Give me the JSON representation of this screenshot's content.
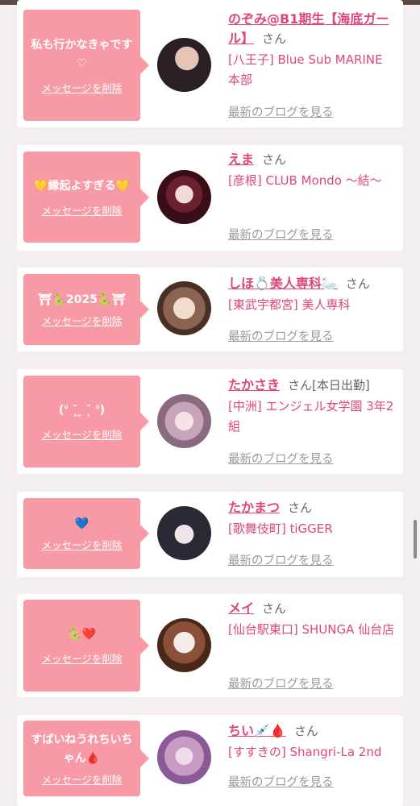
{
  "cards": [
    {
      "message": "私も行かなきゃです♡",
      "delete_label": "メッセージを削除",
      "name": "のぞみ@B1期生【海底ガール】",
      "honorific": "さん",
      "extra": "",
      "shop": "[八王子] Blue Sub MARINE 本部",
      "blog_link": "最新のブログを見る",
      "avatar_colors": [
        "#2a2024",
        "#d9b8a8"
      ]
    },
    {
      "message": "💛縁起よすぎる💛",
      "delete_label": "メッセージを削除",
      "name": "えま",
      "honorific": "さん",
      "extra": "",
      "shop": "[彦根] CLUB Mondo 〜結〜",
      "blog_link": "最新のブログを見る",
      "avatar_colors": [
        "#4a1420",
        "#e8d0c8"
      ]
    },
    {
      "message": "⛩🐍2025🐍⛩",
      "delete_label": "メッセージを削除",
      "name": "しほ💍美人専科🦢",
      "honorific": "さん",
      "extra": "",
      "shop": "[東武宇都宮] 美人専科",
      "blog_link": "最新のブログを見る",
      "avatar_colors": [
        "#6b4a38",
        "#f0d8c8"
      ]
    },
    {
      "message": "(ᐡ ˘̩̩̩ ̫ ˘̩̩̩ ᐡ)",
      "delete_label": "メッセージを削除",
      "name": "たかさき",
      "honorific": "さん",
      "extra": "[本日出勤]",
      "shop": "[中洲] エンジェル女学園 3年2組",
      "blog_link": "最新のブログを見る",
      "avatar_colors": [
        "#e8c8d8",
        "#b89aa8"
      ]
    },
    {
      "message": "💙",
      "delete_label": "メッセージを削除",
      "name": "たかまつ",
      "honorific": "さん",
      "extra": "",
      "shop": "[歌舞伎町] tiGGER",
      "blog_link": "最新のブログを見る",
      "avatar_colors": [
        "#1e1e28",
        "#e8e0e8"
      ]
    },
    {
      "message": "🐍❤️",
      "delete_label": "メッセージを削除",
      "name": "メイ",
      "honorific": "さん",
      "extra": "",
      "shop": "[仙台駅東口] SHUNGA 仙台店",
      "blog_link": "最新のブログを見る",
      "avatar_colors": [
        "#5a3020",
        "#f0e0e0"
      ]
    },
    {
      "message": "すぱいねうれちいちゃん🩸",
      "delete_label": "メッセージを削除",
      "name": "ちい💉🩸",
      "honorific": "さん",
      "extra": "",
      "shop": "[すすきの] Shangri-La 2nd",
      "blog_link": "最新のブログを見る",
      "avatar_colors": [
        "#c8a0c0",
        "#a070a8"
      ]
    }
  ]
}
